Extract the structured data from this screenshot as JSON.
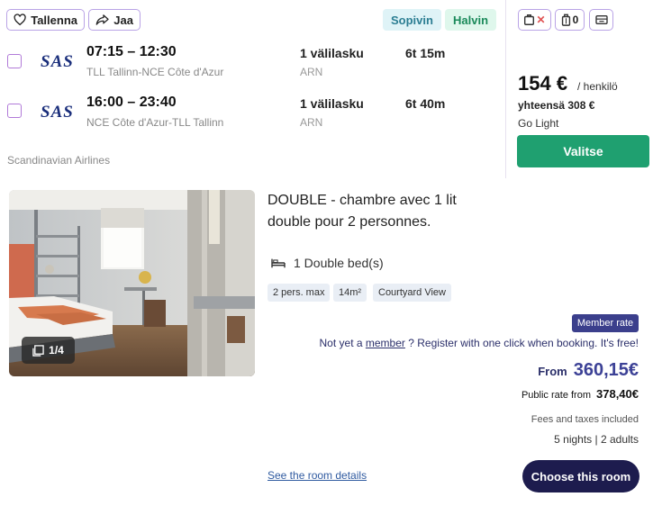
{
  "flight": {
    "save_label": "Tallenna",
    "share_label": "Jaa",
    "tags": [
      "Sopivin",
      "Halvin"
    ],
    "baggage": {
      "cabin_count": "0"
    },
    "legs": [
      {
        "times": "07:15 – 12:30",
        "route": "TLL Tallinn-NCE Côte d'Azur",
        "stops": "1 välilasku",
        "via": "ARN",
        "duration": "6t 15m"
      },
      {
        "times": "16:00 – 23:40",
        "route": "NCE Côte d'Azur-TLL Tallinn",
        "stops": "1 välilasku",
        "via": "ARN",
        "duration": "6t 40m"
      }
    ],
    "airline_logo_text": "SAS",
    "airline_name": "Scandinavian Airlines",
    "price": "154 €",
    "price_unit": "/ henkilö",
    "total": "yhteensä 308 €",
    "fare_name": "Go Light",
    "select_label": "Valitse",
    "colors": {
      "accent": "#b9a3e6",
      "select": "#1fa070",
      "logo": "#1a2e7b"
    }
  },
  "hotel": {
    "photo_counter": "1/4",
    "room_title": "DOUBLE - chambre avec 1 lit double pour 2 personnes.",
    "bed": "1 Double bed(s)",
    "features": [
      "2 pers. max",
      "14m²",
      "Courtyard View"
    ],
    "member_badge": "Member rate",
    "member_prefix": "Not yet a",
    "member_link": "member",
    "member_suffix": "? Register with one click when booking. It's free!",
    "from_label": "From",
    "from_price": "360,15€",
    "public_label": "Public rate from",
    "public_price": "378,40€",
    "fees": "Fees and taxes included",
    "stay": "5 nights | 2 adults",
    "details_link": "See the room details",
    "choose_label": "Choose this room",
    "colors": {
      "brand": "#1d1c4e",
      "price": "#3c4196",
      "badge": "#3b3f8c"
    }
  }
}
